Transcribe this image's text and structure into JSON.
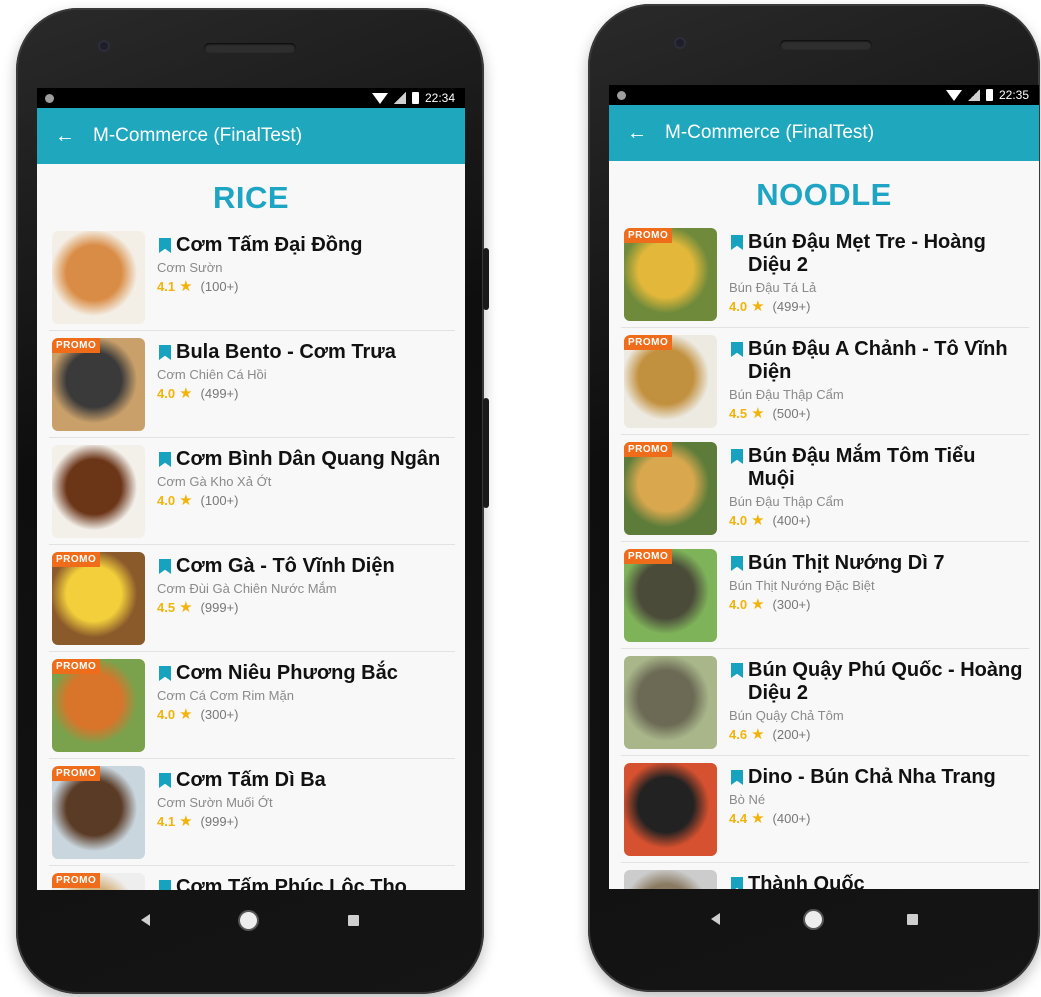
{
  "screens": [
    {
      "status_time": "22:34",
      "app_title": "M-Commerce (FinalTest)",
      "category": "RICE",
      "items": [
        {
          "name": "Cơm Tấm Đại Đồng",
          "dish": "Cơm Sườn",
          "rating": "4.1",
          "count": "(100+)",
          "promo": false,
          "colors": [
            "#d98c45",
            "#f4efe6"
          ]
        },
        {
          "name": "Bula Bento - Cơm Trưa",
          "dish": "Cơm Chiên Cá Hồi",
          "rating": "4.0",
          "count": "(499+)",
          "promo": true,
          "colors": [
            "#3a3a3a",
            "#c9a06a"
          ]
        },
        {
          "name": "Cơm Bình Dân Quang Ngân",
          "dish": "Cơm Gà Kho Xả Ớt",
          "rating": "4.0",
          "count": "(100+)",
          "promo": false,
          "colors": [
            "#6b3518",
            "#f3f0ea"
          ]
        },
        {
          "name": "Cơm Gà - Tô Vĩnh Diện",
          "dish": "Cơm Đùi Gà Chiên Nước Mắm",
          "rating": "4.5",
          "count": "(999+)",
          "promo": true,
          "colors": [
            "#f2cf3b",
            "#8b5a2b"
          ]
        },
        {
          "name": "Cơm Niêu Phương Bắc",
          "dish": "Cơm Cá Cơm Rim Mặn",
          "rating": "4.0",
          "count": "(300+)",
          "promo": true,
          "colors": [
            "#d8752a",
            "#7aa24c"
          ]
        },
        {
          "name": "Cơm Tấm Dì Ba",
          "dish": "Cơm Sườn Muối Ớt",
          "rating": "4.1",
          "count": "(999+)",
          "promo": true,
          "colors": [
            "#5a3b26",
            "#c9d6de"
          ]
        },
        {
          "name": "Cơm Tấm Phúc Lộc Thọ",
          "dish": "",
          "rating": "",
          "count": "",
          "promo": true,
          "colors": [
            "#d4b07a",
            "#eeeeee"
          ]
        }
      ]
    },
    {
      "status_time": "22:35",
      "app_title": "M-Commerce (FinalTest)",
      "category": "NOODLE",
      "items": [
        {
          "name": "Bún Đậu Mẹt Tre - Hoàng Diệu 2",
          "dish": "Bún Đậu Tá Lả",
          "rating": "4.0",
          "count": "(499+)",
          "promo": true,
          "colors": [
            "#e3b83a",
            "#6f8a3b"
          ]
        },
        {
          "name": "Bún Đậu A Chảnh - Tô Vĩnh Diện",
          "dish": "Bún Đậu Thập Cẩm",
          "rating": "4.5",
          "count": "(500+)",
          "promo": true,
          "colors": [
            "#c2913f",
            "#edeae2"
          ]
        },
        {
          "name": "Bún Đậu Mắm Tôm Tiểu Muội",
          "dish": "Bún Đậu Thập Cẩm",
          "rating": "4.0",
          "count": "(400+)",
          "promo": true,
          "colors": [
            "#d9a84e",
            "#5d7c3a"
          ]
        },
        {
          "name": "Bún Thịt Nướng Dì 7",
          "dish": "Bún Thịt Nướng Đặc Biệt",
          "rating": "4.0",
          "count": "(300+)",
          "promo": true,
          "colors": [
            "#4b4b3a",
            "#7fb35a"
          ]
        },
        {
          "name": "Bún Quậy Phú Quốc - Hoàng Diệu 2",
          "dish": "Bún Quậy Chả Tôm",
          "rating": "4.6",
          "count": "(200+)",
          "promo": false,
          "colors": [
            "#6c6a55",
            "#a8b68a"
          ]
        },
        {
          "name": "Dino - Bún Chả Nha Trang",
          "dish": "Bò Né",
          "rating": "4.4",
          "count": "(400+)",
          "promo": false,
          "colors": [
            "#222222",
            "#d5512f"
          ]
        },
        {
          "name": "Thành Quốc",
          "dish": "",
          "rating": "",
          "count": "",
          "promo": false,
          "colors": [
            "#8a7a62",
            "#cccccc"
          ]
        }
      ]
    }
  ],
  "promo_label": "PROMO",
  "back_glyph": "←",
  "star_glyph": "★",
  "accent_color": "#1fa7be",
  "promo_color": "#ef6c1a",
  "star_color": "#f2b30a"
}
